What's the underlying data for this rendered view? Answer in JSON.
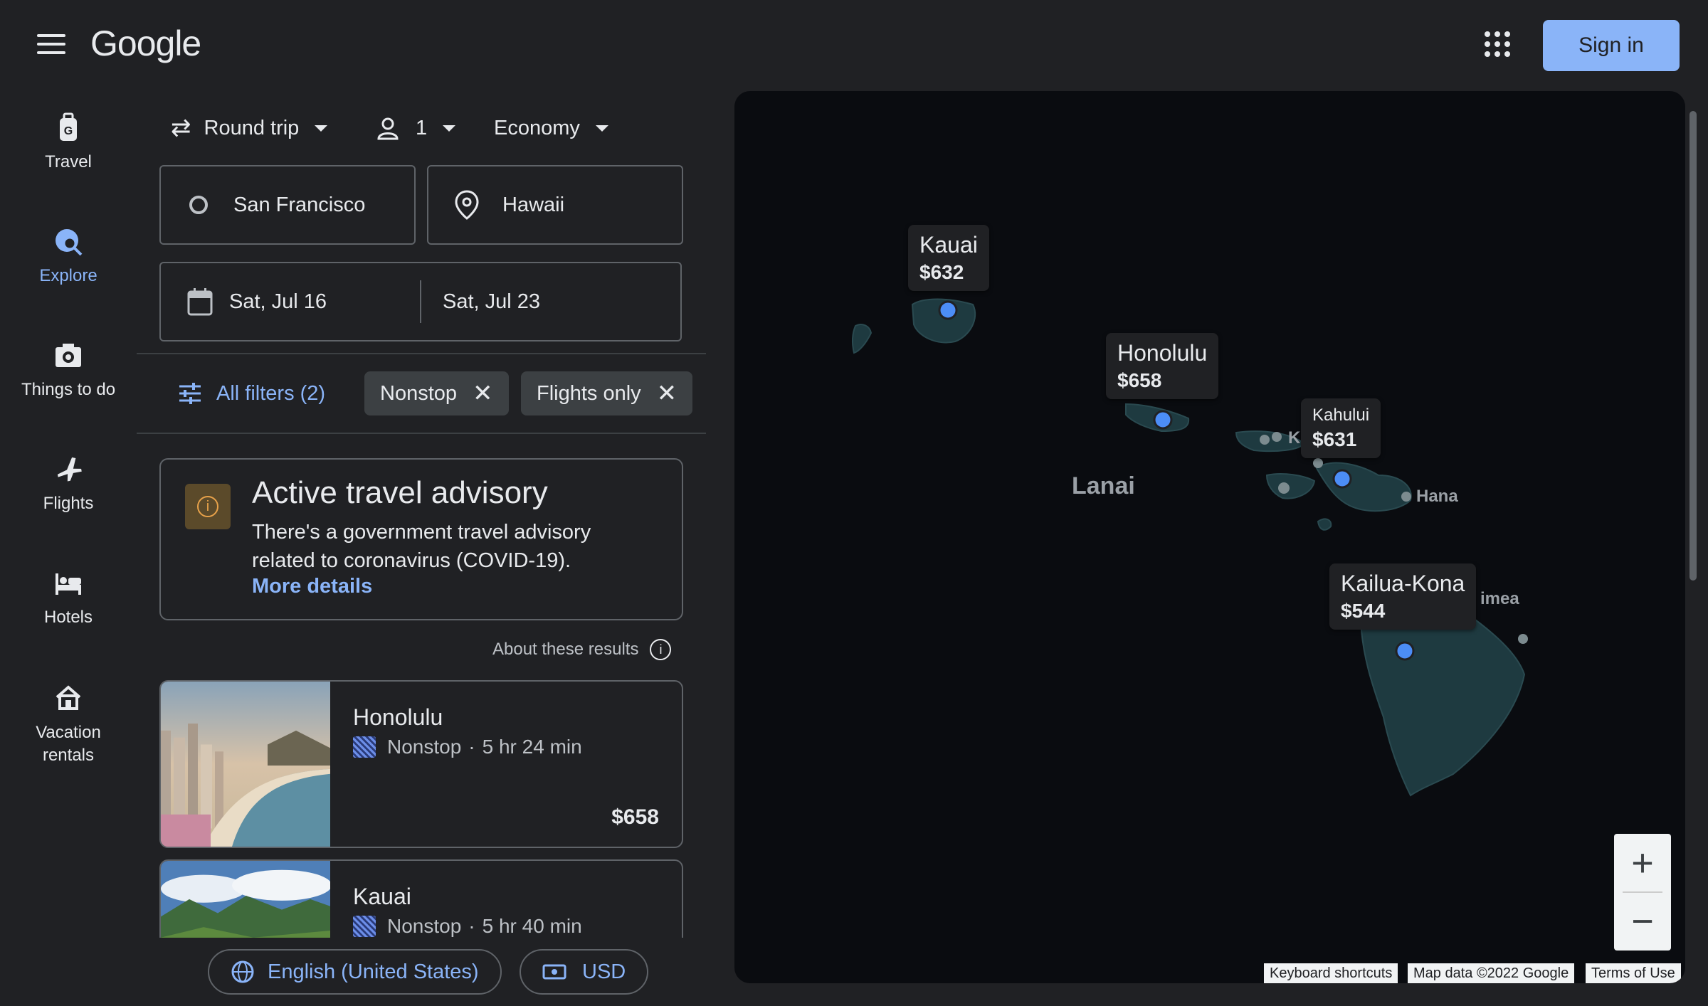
{
  "header": {
    "logo": "Google",
    "sign_in": "Sign in"
  },
  "rail": [
    {
      "label": "Travel",
      "icon": "luggage-icon"
    },
    {
      "label": "Explore",
      "icon": "explore-icon"
    },
    {
      "label": "Things to do",
      "icon": "camera-icon"
    },
    {
      "label": "Flights",
      "icon": "airplane-icon"
    },
    {
      "label": "Hotels",
      "icon": "bed-icon"
    },
    {
      "label": "Vacation rentals",
      "icon": "house-icon"
    }
  ],
  "search": {
    "trip_type": "Round trip",
    "passengers": "1",
    "cabin": "Economy",
    "origin": "San Francisco",
    "destination": "Hawaii",
    "depart": "Sat, Jul 16",
    "return": "Sat, Jul 23"
  },
  "filters": {
    "all_filters": "All filters (2)",
    "chips": [
      "Nonstop",
      "Flights only"
    ]
  },
  "advisory": {
    "title": "Active travel advisory",
    "body": "There's a government travel advisory related to coronavirus (COVID-19).",
    "link": "More details"
  },
  "about": "About these results",
  "results": [
    {
      "name": "Honolulu",
      "stops": "Nonstop",
      "duration": "5 hr 24 min",
      "price": "$658"
    },
    {
      "name": "Kauai",
      "stops": "Nonstop",
      "duration": "5 hr 40 min",
      "price": ""
    }
  ],
  "footer": {
    "language": "English (United States)",
    "currency": "USD"
  },
  "map": {
    "callouts": [
      {
        "name": "Kauai",
        "price": "$632"
      },
      {
        "name": "Honolulu",
        "price": "$658"
      },
      {
        "name": "Kahului",
        "price": "$631"
      },
      {
        "name": "Kailua-Kona",
        "price": "$544"
      }
    ],
    "towns": [
      "Lanai",
      "Hana",
      "Ka",
      "imea"
    ],
    "attribution": [
      "Keyboard shortcuts",
      "Map data ©2022 Google",
      "Terms of Use"
    ]
  },
  "colors": {
    "background": "#202124",
    "accent": "#8ab4f8",
    "advisory": "#e8a24a"
  }
}
